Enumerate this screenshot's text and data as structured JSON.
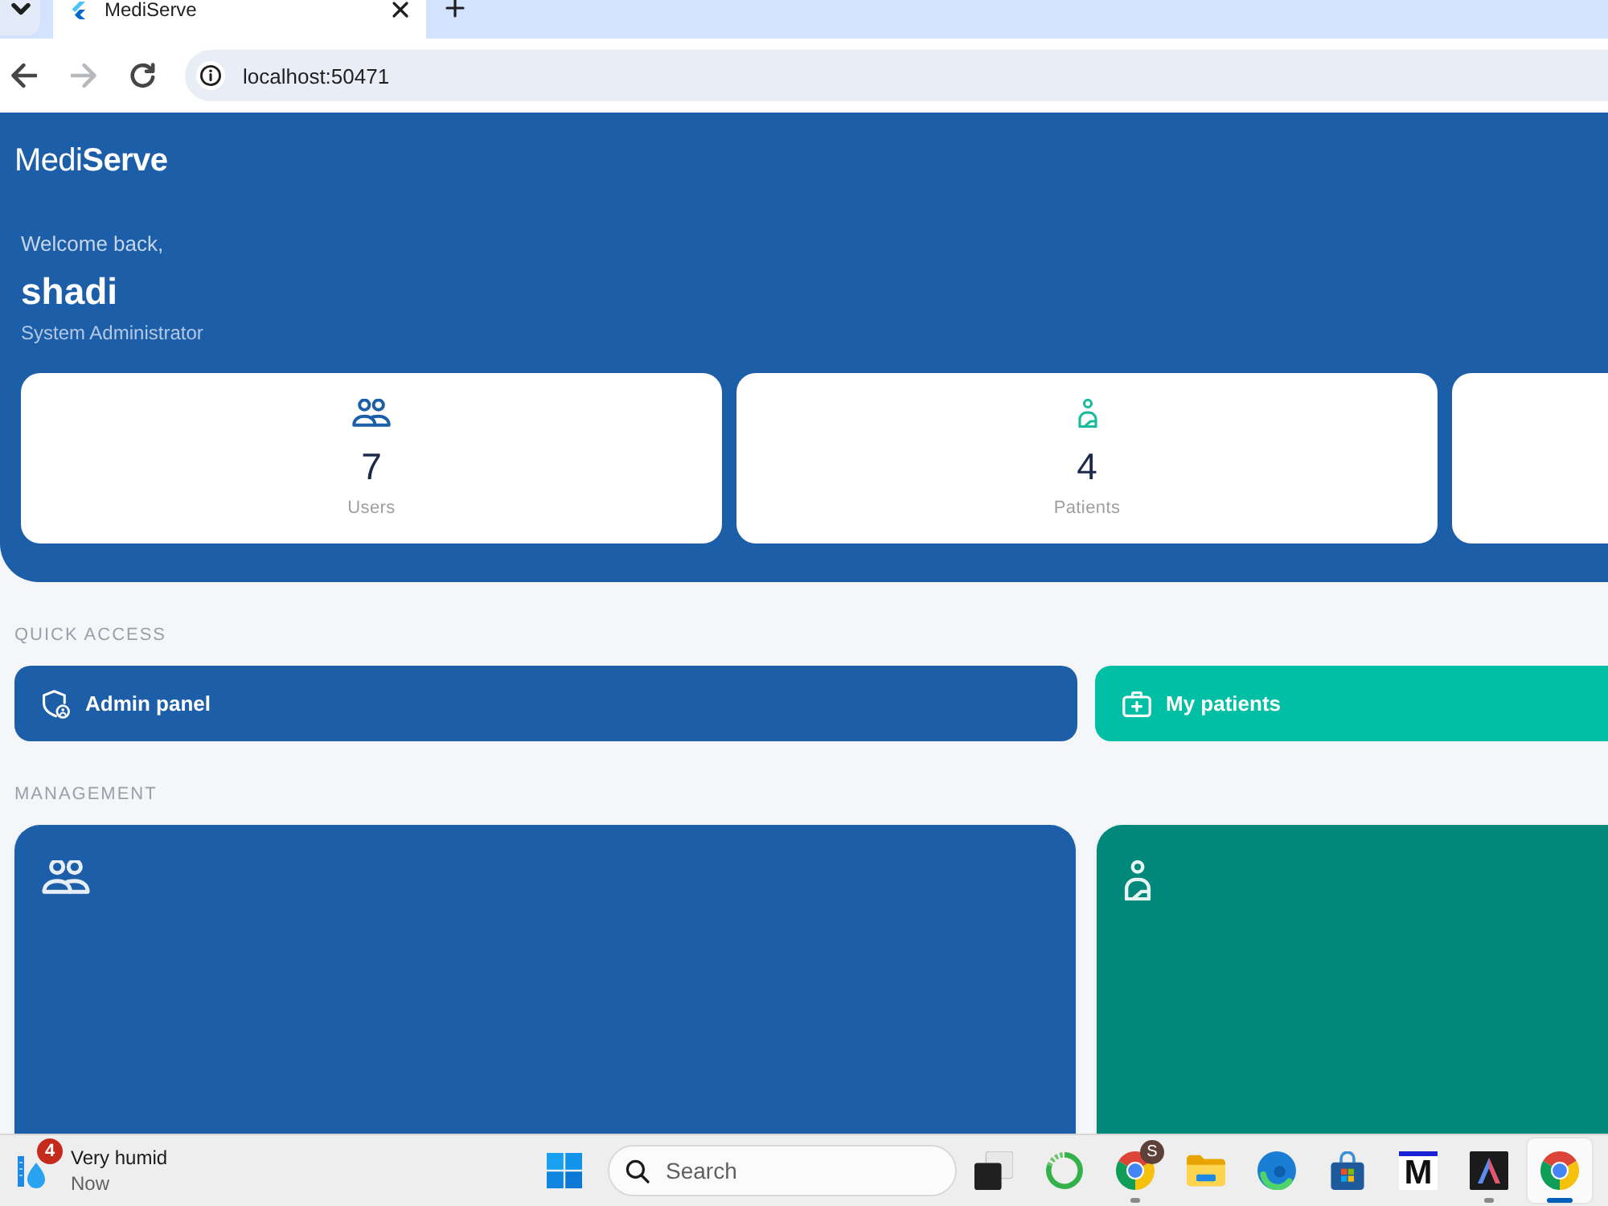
{
  "browser": {
    "tabs": [
      {
        "title": "MediServe",
        "selected": true
      }
    ],
    "nav": [
      {
        "kind": "back",
        "disabled": false
      },
      {
        "kind": "forward",
        "disabled": true
      },
      {
        "kind": "reload",
        "disabled": false
      }
    ],
    "address": "localhost:50471"
  },
  "header": {
    "brand": "Medi**Serve**",
    "greeting": "Welcome back,",
    "user_name": "shadi",
    "role": "System Administrator",
    "stats": [
      {
        "kind": "users",
        "value": "7",
        "label": "Users",
        "color": "#1c5fa8"
      },
      {
        "kind": "patients",
        "value": "4",
        "label": "Patients",
        "color": "#1abc9c"
      },
      {
        "kind": "blank"
      }
    ]
  },
  "quick_access": {
    "title": "QUICK ACCESS",
    "items": [
      {
        "kind": "admin",
        "label": "Admin panel",
        "color": "#1c5fa8"
      },
      {
        "kind": "patients",
        "label": "My patients",
        "color": "#00bfa5"
      }
    ]
  },
  "management": {
    "title": "MANAGEMENT",
    "cards": [
      {
        "kind": "users",
        "color": "#1c5fa8"
      },
      {
        "kind": "patients",
        "color": "#00897b"
      }
    ]
  },
  "taskbar": {
    "weather": {
      "text": "Very humid",
      "subtext": "Now",
      "badge": "4"
    },
    "search": {
      "placeholder": "Search"
    },
    "apps": [
      {
        "kind": "stack",
        "running": false,
        "selected": false
      },
      {
        "kind": "ring",
        "running": false,
        "selected": false
      },
      {
        "kind": "browser",
        "badge": "S",
        "running": true,
        "selected": false
      },
      {
        "kind": "folder",
        "running": false,
        "selected": false
      },
      {
        "kind": "swirl",
        "running": false,
        "selected": false
      },
      {
        "kind": "bag",
        "running": false,
        "selected": false
      },
      {
        "kind": "letter",
        "text": "M",
        "running": false,
        "selected": false
      },
      {
        "kind": "peak",
        "running": true,
        "selected": false
      },
      {
        "kind": "browser",
        "running": true,
        "selected": true
      }
    ]
  }
}
